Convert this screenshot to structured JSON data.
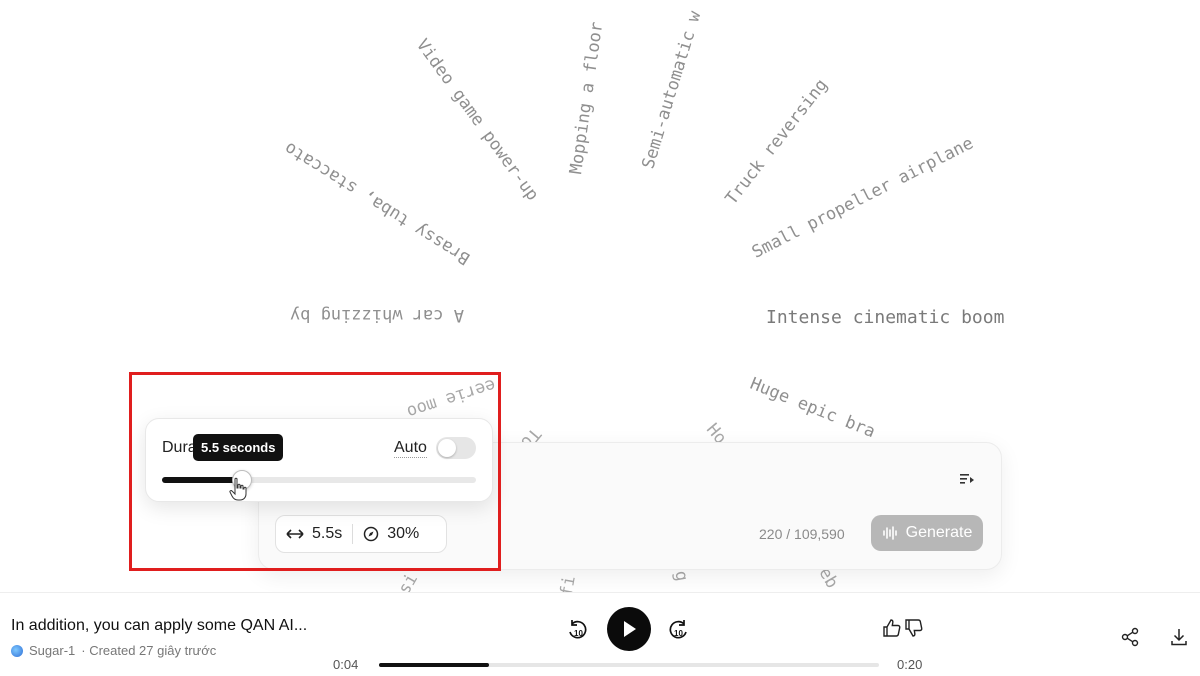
{
  "prompts": [
    {
      "text": "Video game power-up"
    },
    {
      "text": "Mopping a floor"
    },
    {
      "text": "Semi-automatic w"
    },
    {
      "text": "Truck reversing"
    },
    {
      "text": "Small propeller airplane"
    },
    {
      "text": "Brassy tuba, staccato"
    },
    {
      "text": "A car whizzing by"
    },
    {
      "text": "Intense cinematic boom"
    },
    {
      "text": "Huge epic bra"
    },
    {
      "text": "eerie moo"
    },
    {
      "text": "To"
    },
    {
      "text": "Ho"
    },
    {
      "text": "si"
    },
    {
      "text": "fi"
    },
    {
      "text": "g"
    },
    {
      "text": "eb"
    }
  ],
  "duration": {
    "label": "Dura",
    "tooltip": "5.5 seconds",
    "auto_label": "Auto",
    "auto_enabled": false,
    "slider_fraction": 0.25
  },
  "composer": {
    "duration_chip": "5.5s",
    "influence_chip": "30%",
    "char_counter": "220 / 109,590",
    "generate_label": "Generate"
  },
  "player": {
    "title": "In addition, you can apply some QAN AI...",
    "model": "Sugar-1",
    "meta": "· Created 27 giây trước",
    "rewind_label": "10",
    "forward_label": "10",
    "current_time": "0:04",
    "total_time": "0:20",
    "progress_fraction": 0.22
  },
  "colors": {
    "highlight": "#e01e1e",
    "accent": "#111111",
    "generate_disabled": "#b7b7b7"
  }
}
